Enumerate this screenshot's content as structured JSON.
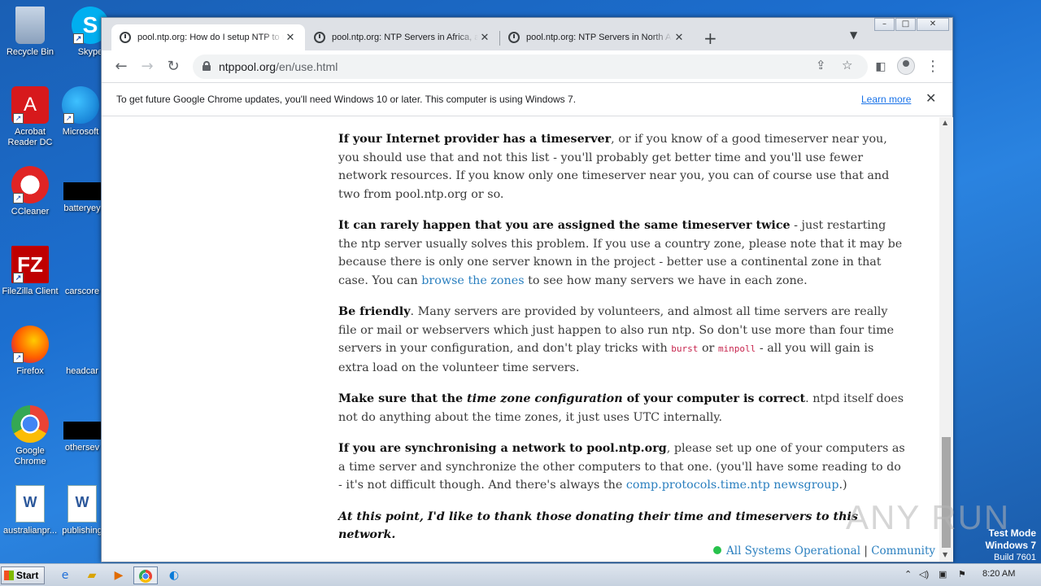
{
  "desktop": {
    "icons": [
      {
        "label": "Recycle Bin",
        "icon": "recycle-bin-icon"
      },
      {
        "label": "Skype",
        "icon": "skype-icon"
      },
      {
        "label": "Acrobat Reader DC",
        "icon": "acrobat-icon"
      },
      {
        "label": "Microsoft",
        "icon": "edge-icon"
      },
      {
        "label": "CCleaner",
        "icon": "ccleaner-icon"
      },
      {
        "label": "batteryey",
        "icon": "file-icon"
      },
      {
        "label": "FileZilla Client",
        "icon": "filezilla-icon"
      },
      {
        "label": "carscore",
        "icon": "file-icon"
      },
      {
        "label": "Firefox",
        "icon": "firefox-icon"
      },
      {
        "label": "headcar",
        "icon": "file-icon"
      },
      {
        "label": "Google Chrome",
        "icon": "chrome-icon"
      },
      {
        "label": "othersev",
        "icon": "file-icon"
      },
      {
        "label": "australianpr...",
        "icon": "word-doc-icon"
      },
      {
        "label": "publishing",
        "icon": "word-doc-icon"
      }
    ]
  },
  "browser": {
    "tabs": [
      {
        "title": "pool.ntp.org: How do I setup NTP to use the pool?",
        "active": true
      },
      {
        "title": "pool.ntp.org: NTP Servers in Africa, africa.pool.ntp.org",
        "active": false
      },
      {
        "title": "pool.ntp.org: NTP Servers in North America",
        "active": false
      }
    ],
    "url_host": "ntppool.org",
    "url_path": "/en/use.html",
    "infobar": {
      "message": "To get future Google Chrome updates, you'll need Windows 10 or later. This computer is using Windows 7.",
      "learn_more": "Learn more"
    }
  },
  "article": {
    "p1_bold": "If your Internet provider has a timeserver",
    "p1_text": ", or if you know of a good timeserver near you, you should use that and not this list - you'll probably get better time and you'll use fewer network resources. If you know only one timeserver near you, you can of course use that and two from pool.ntp.org or so.",
    "p2_bold": "It can rarely happen that you are assigned the same timeserver twice",
    "p2_text": " - just restarting the ntp server usually solves this problem. If you use a country zone, please note that it may be because there is only one server known in the project - better use a continental zone in that case. You can ",
    "p2_link": "browse the zones",
    "p2_tail": " to see how many servers we have in each zone.",
    "p3_bold": "Be friendly",
    "p3_text": ". Many servers are provided by volunteers, and almost all time servers are really file or mail or webservers which just happen to also run ntp. So don't use more than four time servers in your configuration, and don't play tricks with ",
    "p3_code1": "burst",
    "p3_or": " or ",
    "p3_code2": "minpoll",
    "p3_tail": " - all you will gain is extra load on the volunteer time servers.",
    "p4_bold1": "Make sure that the ",
    "p4_em": "time zone configuration",
    "p4_bold2": " of your computer is correct",
    "p4_text": ". ntpd itself does not do anything about the time zones, it just uses UTC internally.",
    "p5_bold": "If you are synchronising a network to pool.ntp.org",
    "p5_text": ", please set up one of your computers as a time server and synchronize the other computers to that one. (you'll have some reading to do - it's not difficult though. And there's always the ",
    "p5_link": "comp.protocols.time.ntp newsgroup",
    "p5_tail": ".)",
    "p6": "At this point, I'd like to thank those donating their time and timeservers to this network."
  },
  "footer": {
    "status": "All Systems Operational",
    "separator": "|",
    "community": "Community"
  },
  "taskbar": {
    "start": "Start",
    "clock": "8:20 AM"
  },
  "watermark": "ANY RUN",
  "testmode": {
    "line1": "Test Mode",
    "line2": "Windows 7",
    "line3": "Build 7601"
  }
}
